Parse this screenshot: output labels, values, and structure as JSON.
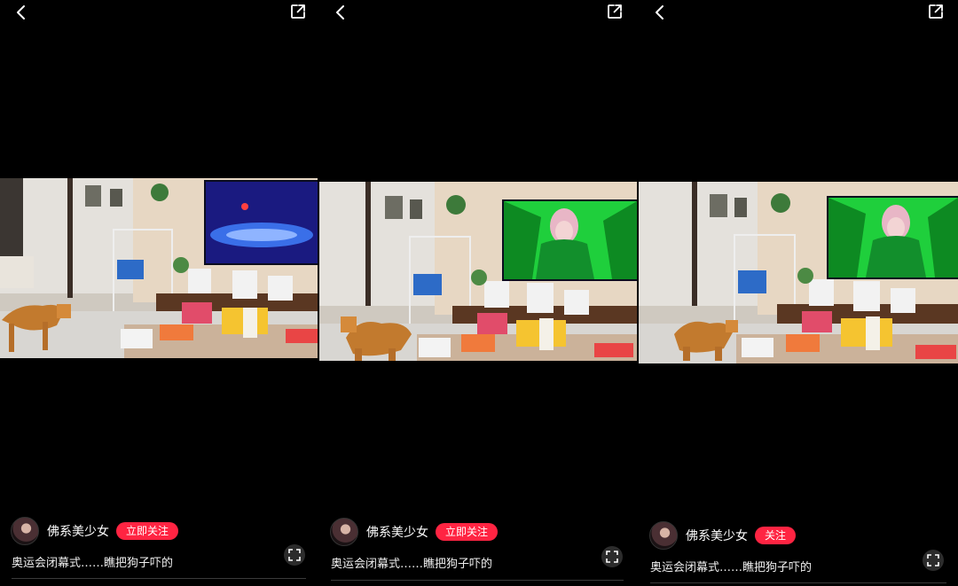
{
  "panels": [
    {
      "author": {
        "name": "佛系美少女",
        "follow_label": "立即关注"
      },
      "caption": "奥运会闭幕式……瞧把狗子吓的",
      "video": {
        "tv_scene": "stadium"
      },
      "icons": {
        "back": "chevron-left-icon",
        "share": "share-icon",
        "fullscreen": "fullscreen-icon"
      }
    },
    {
      "author": {
        "name": "佛系美少女",
        "follow_label": "立即关注"
      },
      "caption": "奥运会闭幕式……瞧把狗子吓的",
      "video": {
        "tv_scene": "performer"
      },
      "icons": {
        "back": "chevron-left-icon",
        "share": "share-icon",
        "fullscreen": "fullscreen-icon"
      }
    },
    {
      "author": {
        "name": "佛系美少女",
        "follow_label": "关注"
      },
      "caption": "奥运会闭幕式……瞧把狗子吓的",
      "video": {
        "tv_scene": "performer"
      },
      "icons": {
        "back": "chevron-left-icon",
        "share": "share-icon",
        "fullscreen": "fullscreen-icon"
      }
    }
  ],
  "colors": {
    "follow_button": "#ff2442",
    "background": "#000000"
  }
}
